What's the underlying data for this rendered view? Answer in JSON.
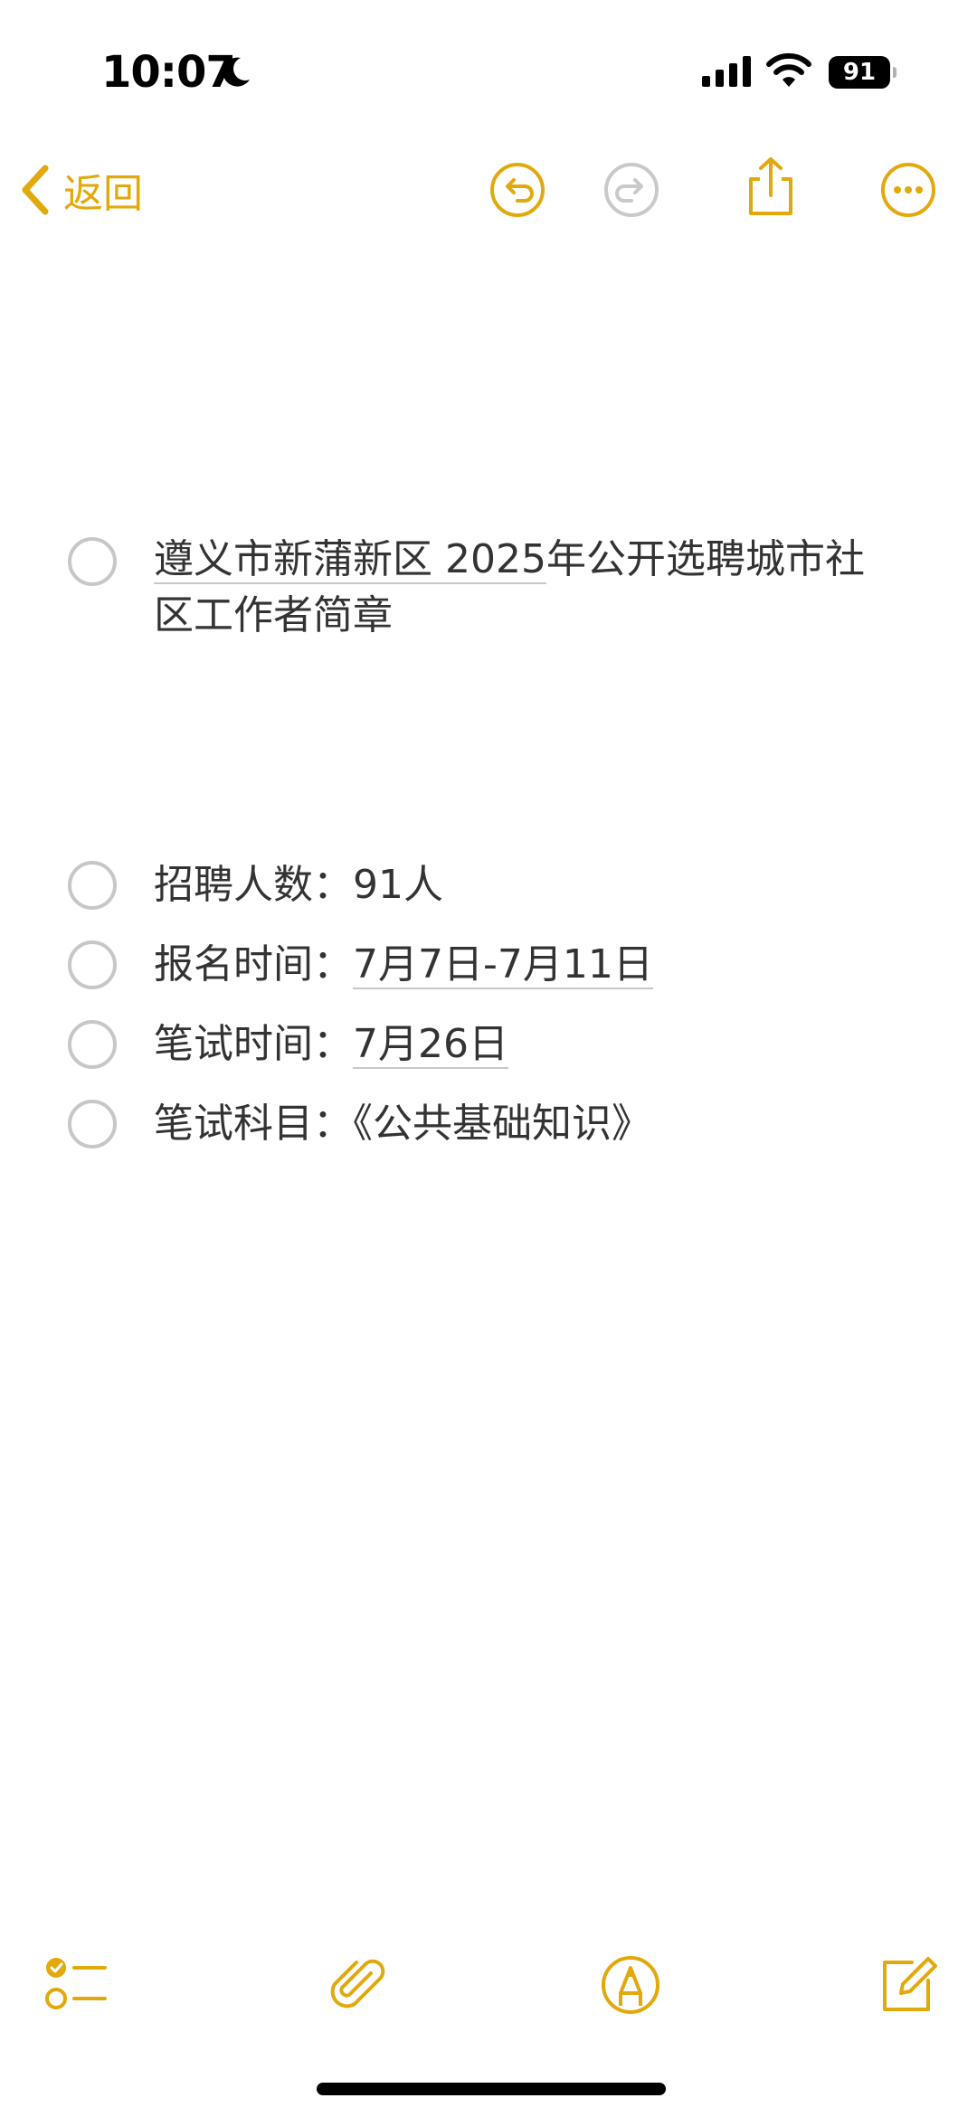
{
  "status_bar": {
    "time": "10:07",
    "battery": "91"
  },
  "toolbar": {
    "back_label": "返回"
  },
  "note": {
    "title_part1": "遵义市新蒲新区 2025",
    "title_part2": "年公开选聘城市社",
    "title_line2": "区工作者简章",
    "items": [
      {
        "label": "招聘人数：",
        "value": "91人"
      },
      {
        "label": "报名时间：",
        "value": "7月7日-7月11日"
      },
      {
        "label": "笔试时间：",
        "value": "7月26日"
      },
      {
        "label": "笔试科目：",
        "value": "《公共基础知识》"
      }
    ]
  },
  "colors": {
    "accent": "#e1a90b",
    "text": "#333333",
    "circle": "#c7c7c7",
    "disabled_icon": "#c9c9c9"
  }
}
